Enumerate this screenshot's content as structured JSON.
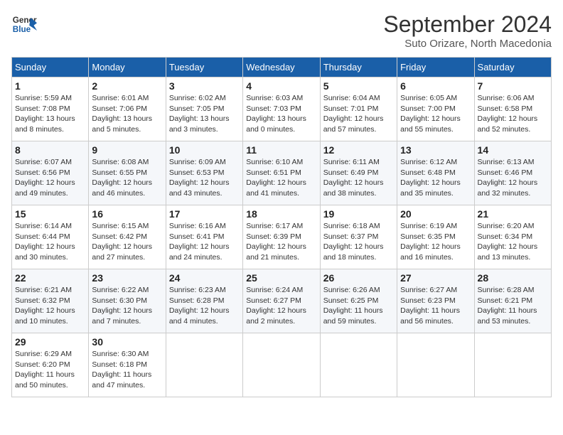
{
  "header": {
    "logo_line1": "General",
    "logo_line2": "Blue",
    "month": "September 2024",
    "location": "Suto Orizare, North Macedonia"
  },
  "weekdays": [
    "Sunday",
    "Monday",
    "Tuesday",
    "Wednesday",
    "Thursday",
    "Friday",
    "Saturday"
  ],
  "weeks": [
    [
      {
        "day": "1",
        "detail": "Sunrise: 5:59 AM\nSunset: 7:08 PM\nDaylight: 13 hours\nand 8 minutes."
      },
      {
        "day": "2",
        "detail": "Sunrise: 6:01 AM\nSunset: 7:06 PM\nDaylight: 13 hours\nand 5 minutes."
      },
      {
        "day": "3",
        "detail": "Sunrise: 6:02 AM\nSunset: 7:05 PM\nDaylight: 13 hours\nand 3 minutes."
      },
      {
        "day": "4",
        "detail": "Sunrise: 6:03 AM\nSunset: 7:03 PM\nDaylight: 13 hours\nand 0 minutes."
      },
      {
        "day": "5",
        "detail": "Sunrise: 6:04 AM\nSunset: 7:01 PM\nDaylight: 12 hours\nand 57 minutes."
      },
      {
        "day": "6",
        "detail": "Sunrise: 6:05 AM\nSunset: 7:00 PM\nDaylight: 12 hours\nand 55 minutes."
      },
      {
        "day": "7",
        "detail": "Sunrise: 6:06 AM\nSunset: 6:58 PM\nDaylight: 12 hours\nand 52 minutes."
      }
    ],
    [
      {
        "day": "8",
        "detail": "Sunrise: 6:07 AM\nSunset: 6:56 PM\nDaylight: 12 hours\nand 49 minutes."
      },
      {
        "day": "9",
        "detail": "Sunrise: 6:08 AM\nSunset: 6:55 PM\nDaylight: 12 hours\nand 46 minutes."
      },
      {
        "day": "10",
        "detail": "Sunrise: 6:09 AM\nSunset: 6:53 PM\nDaylight: 12 hours\nand 43 minutes."
      },
      {
        "day": "11",
        "detail": "Sunrise: 6:10 AM\nSunset: 6:51 PM\nDaylight: 12 hours\nand 41 minutes."
      },
      {
        "day": "12",
        "detail": "Sunrise: 6:11 AM\nSunset: 6:49 PM\nDaylight: 12 hours\nand 38 minutes."
      },
      {
        "day": "13",
        "detail": "Sunrise: 6:12 AM\nSunset: 6:48 PM\nDaylight: 12 hours\nand 35 minutes."
      },
      {
        "day": "14",
        "detail": "Sunrise: 6:13 AM\nSunset: 6:46 PM\nDaylight: 12 hours\nand 32 minutes."
      }
    ],
    [
      {
        "day": "15",
        "detail": "Sunrise: 6:14 AM\nSunset: 6:44 PM\nDaylight: 12 hours\nand 30 minutes."
      },
      {
        "day": "16",
        "detail": "Sunrise: 6:15 AM\nSunset: 6:42 PM\nDaylight: 12 hours\nand 27 minutes."
      },
      {
        "day": "17",
        "detail": "Sunrise: 6:16 AM\nSunset: 6:41 PM\nDaylight: 12 hours\nand 24 minutes."
      },
      {
        "day": "18",
        "detail": "Sunrise: 6:17 AM\nSunset: 6:39 PM\nDaylight: 12 hours\nand 21 minutes."
      },
      {
        "day": "19",
        "detail": "Sunrise: 6:18 AM\nSunset: 6:37 PM\nDaylight: 12 hours\nand 18 minutes."
      },
      {
        "day": "20",
        "detail": "Sunrise: 6:19 AM\nSunset: 6:35 PM\nDaylight: 12 hours\nand 16 minutes."
      },
      {
        "day": "21",
        "detail": "Sunrise: 6:20 AM\nSunset: 6:34 PM\nDaylight: 12 hours\nand 13 minutes."
      }
    ],
    [
      {
        "day": "22",
        "detail": "Sunrise: 6:21 AM\nSunset: 6:32 PM\nDaylight: 12 hours\nand 10 minutes."
      },
      {
        "day": "23",
        "detail": "Sunrise: 6:22 AM\nSunset: 6:30 PM\nDaylight: 12 hours\nand 7 minutes."
      },
      {
        "day": "24",
        "detail": "Sunrise: 6:23 AM\nSunset: 6:28 PM\nDaylight: 12 hours\nand 4 minutes."
      },
      {
        "day": "25",
        "detail": "Sunrise: 6:24 AM\nSunset: 6:27 PM\nDaylight: 12 hours\nand 2 minutes."
      },
      {
        "day": "26",
        "detail": "Sunrise: 6:26 AM\nSunset: 6:25 PM\nDaylight: 11 hours\nand 59 minutes."
      },
      {
        "day": "27",
        "detail": "Sunrise: 6:27 AM\nSunset: 6:23 PM\nDaylight: 11 hours\nand 56 minutes."
      },
      {
        "day": "28",
        "detail": "Sunrise: 6:28 AM\nSunset: 6:21 PM\nDaylight: 11 hours\nand 53 minutes."
      }
    ],
    [
      {
        "day": "29",
        "detail": "Sunrise: 6:29 AM\nSunset: 6:20 PM\nDaylight: 11 hours\nand 50 minutes."
      },
      {
        "day": "30",
        "detail": "Sunrise: 6:30 AM\nSunset: 6:18 PM\nDaylight: 11 hours\nand 47 minutes."
      },
      null,
      null,
      null,
      null,
      null
    ]
  ]
}
